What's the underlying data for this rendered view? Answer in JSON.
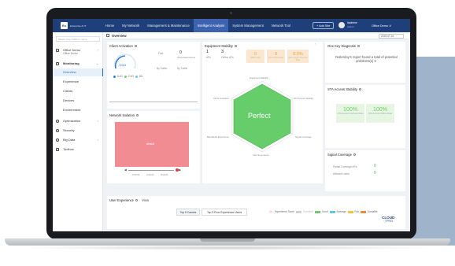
{
  "topbar": {
    "logo": "Ex",
    "brand": "Enterprise AI IT",
    "nav": [
      "Home",
      "My Network",
      "Management & Maintenance",
      "Intelligent Analysis",
      "System Management",
      "Network Tool"
    ],
    "active_nav": "Intelligent Analysis",
    "add_site": "+ Add Site",
    "user_name": "itadmine",
    "user_role": "Admin",
    "org_selector": "Office Demo ∨"
  },
  "sidebar": {
    "search_placeholder": "Please enter SSID or name",
    "org_name": "Office Demo",
    "org_sub": "Office Demo",
    "items": [
      {
        "label": "Monitoring",
        "icon": "monitor-icon"
      },
      {
        "label": "Overview"
      },
      {
        "label": "Experience"
      },
      {
        "label": "Clients"
      },
      {
        "label": "Devices"
      },
      {
        "label": "Environment"
      },
      {
        "label": "Optimization",
        "icon": "optimization-icon"
      },
      {
        "label": "Security",
        "icon": "security-icon"
      },
      {
        "label": "Big Data",
        "icon": "big-data-icon"
      },
      {
        "label": "Toolbox",
        "icon": "toolbox-icon"
      }
    ]
  },
  "main": {
    "title": "Overview",
    "date": "2019-07-01"
  },
  "client_activation": {
    "title": "Client Activation",
    "gauge_label": "Online",
    "first_label": "First",
    "first_value": "0",
    "associated_label": "Associated Clients",
    "by_traffic": "By Traffic",
    "by_traffic_b": "By Traffic",
    "legend": [
      "5.1G",
      "2.4G",
      "5G"
    ]
  },
  "equipment_stability": {
    "title": "Equipment Stability",
    "aps_value": "1",
    "aps_label": "APs",
    "online_value": "3",
    "online_label": "Online APs",
    "tiles": [
      {
        "value": "0",
        "label": "Offline APs"
      },
      {
        "value": "0",
        "label": "APs Online Rate"
      },
      {
        "value": "0.0%",
        "label": "APs Lowest Success Rate"
      }
    ]
  },
  "radar": {
    "center_label": "Perfect",
    "axes": [
      "Equipment Stability",
      "STA Access Stability",
      "Signal Coverage",
      "User Experience",
      "Bandwidth Experience",
      "Client Activation"
    ]
  },
  "one_key": {
    "title": "One Key Diagnosis",
    "text": "Yesterday's report found a total of potential problems(s) 2"
  },
  "sta_access": {
    "title": "STA Access Stability",
    "tiles": [
      {
        "value": "100%",
        "label": "STA Access Success Rate"
      },
      {
        "value": "100%",
        "label": "STA Access Offline Rate"
      }
    ]
  },
  "network_isolation": {
    "title": "Network Isolation",
    "block_label": "default",
    "axis_ticks": [
      "0:00:00",
      "2:00:00",
      "8:00:00"
    ]
  },
  "signal_coverage": {
    "title": "Signal Coverage",
    "rows": [
      {
        "label": "Partial Coverage APs",
        "value": "0"
      },
      {
        "label": "Affected Users",
        "value": "0"
      }
    ]
  },
  "user_experience": {
    "title": "User Experience",
    "view_label": "View",
    "tabs": [
      "Top 5 Causes",
      "Top 5 Poor Experience Users"
    ],
    "legend": [
      {
        "label": "Experience Score",
        "color": "#e8556b"
      },
      {
        "label": "Excellent",
        "color": "#cfd2d6"
      },
      {
        "label": "Good",
        "color": "#6dcb6b"
      },
      {
        "label": "Average",
        "color": "#65c6e6"
      },
      {
        "label": "Fair",
        "color": "#f5c344"
      },
      {
        "label": "Unstable",
        "color": "#f28c3a"
      }
    ]
  },
  "cloud_badge": {
    "line1": "CLOUD",
    "line2": "ⓘPRO"
  },
  "colors": {
    "topbar": "#1e3f7a",
    "active_nav": "#3d63b0",
    "radar_fill": "#67cd6a",
    "isolation_block": "#f28c93",
    "accent": "#1f6bd6"
  }
}
